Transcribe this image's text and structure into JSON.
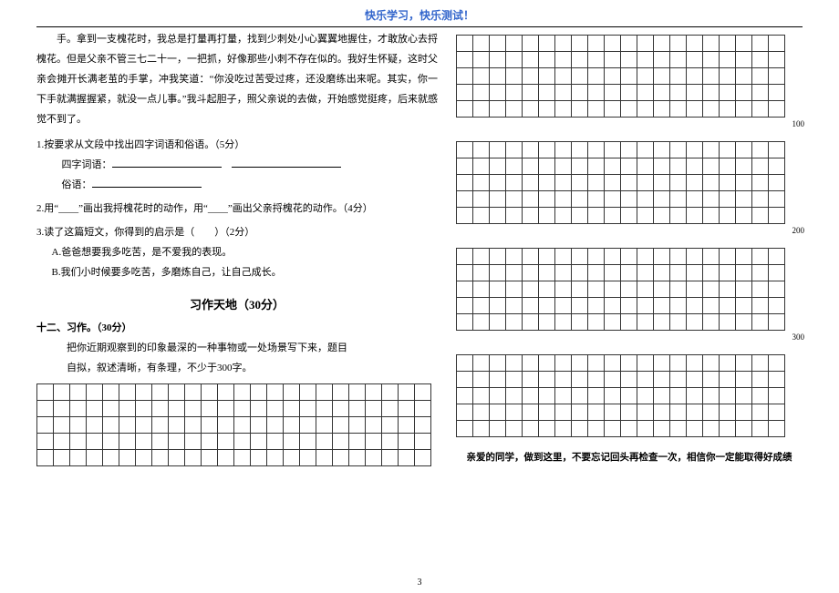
{
  "header": "快乐学习，快乐测试！",
  "passage": "手。拿到一支槐花时，我总是打量再打量，找到少刺处小心翼翼地握住，才敢放心去捋槐花。但是父亲不管三七二十一，一把抓，好像那些小刺不存在似的。我好生怀疑，这时父亲会摊开长满老茧的手掌，冲我笑道：“你没吃过苦受过疼，还没磨练出来呢。其实，你一下手就满握握紧，就没一点儿事。”我斗起胆子，照父亲说的去做，开始感觉挺疼，后来就感觉不到了。",
  "q1": {
    "stem": "1.按要求从文段中找出四字词语和俗语。（5分）",
    "line1_label": "四字词语：",
    "line2_label": "俗语："
  },
  "q2": "2.用“____”画出我捋槐花时的动作，用“____”画出父亲捋槐花的动作。（4分）",
  "q3": {
    "stem": "3.读了这篇短文，你得到的启示是（　　）（2分）",
    "optA": "A.爸爸想要我多吃苦，是不爱我的表现。",
    "optB": "B.我们小时候要多吃苦，多磨炼自己，让自己成长。"
  },
  "section_title": "习作天地（30分）",
  "composition": {
    "heading": "十二、习作。（30分）",
    "text1": "把你近期观察到的印象最深的一种事物或一处场景写下来，题目",
    "text2": "自拟，叙述清晰，有条理，不少于300字。"
  },
  "count_labels": [
    "100",
    "200",
    "300"
  ],
  "footer": "亲爱的同学，做到这里，不要忘记回头再检查一次，相信你一定能取得好成绩",
  "page_number": "3"
}
